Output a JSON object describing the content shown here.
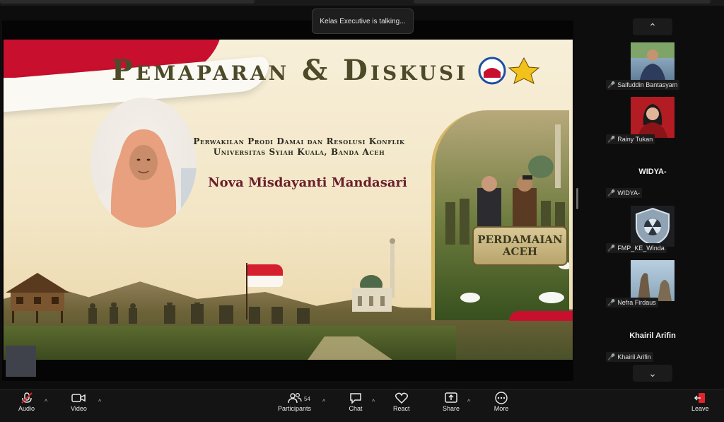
{
  "toast": {
    "text": "Kelas Executive is talking..."
  },
  "slide": {
    "title": "Pemaparan & Diskusi",
    "org_line1": "Perwakilan Prodi Damai dan Resolusi Konflik",
    "org_line2": "Universitas Syiah Kuala, Banda Aceh",
    "speaker": "Nova Misdayanti Mandasari",
    "banner_line1": "PERDAMAIAN",
    "banner_line2": "ACEH"
  },
  "participants_gallery": [
    {
      "name": "Saifuddin Bantasyam",
      "muted": true
    },
    {
      "name": "Rainy Tukan",
      "muted": true
    },
    {
      "name": "WIDYA-",
      "muted": true,
      "display_name": "WIDYA-"
    },
    {
      "name": "FMP_KE_Winda",
      "muted": true
    },
    {
      "name": "Nefra Firdaus",
      "muted": true
    },
    {
      "name": "Khairil Arifin",
      "muted": true,
      "display_name": "Khairil Arifin"
    }
  ],
  "toolbar": {
    "audio": "Audio",
    "video": "Video",
    "participants": "Participants",
    "participants_count": "54",
    "chat": "Chat",
    "react": "React",
    "share": "Share",
    "more": "More",
    "leave": "Leave"
  },
  "colors": {
    "flag_red": "#c8102e",
    "mic_muted": "#e0242a",
    "toolbar_bg": "#141414",
    "title_olive": "#4d4a2a",
    "speaker_maroon": "#6b1f2a"
  }
}
